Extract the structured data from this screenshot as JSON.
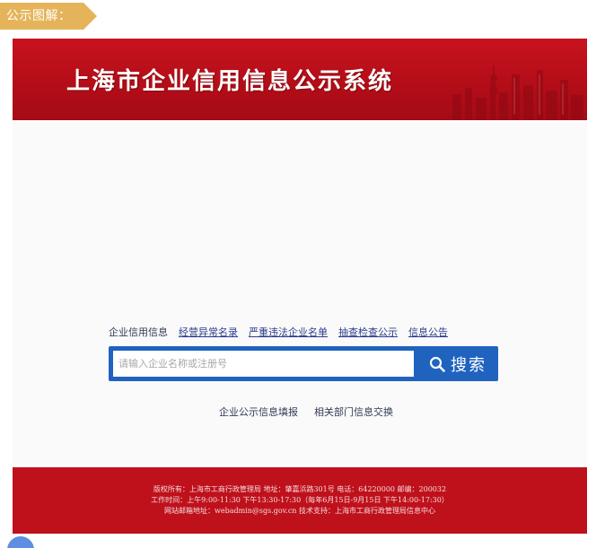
{
  "tag": {
    "label": "公示图解："
  },
  "header": {
    "site_title": "上海市企业信用信息公示系统"
  },
  "nav": {
    "links": [
      "企业信用信息",
      "经营异常名录",
      "严重违法企业名单",
      "抽查检查公示",
      "信息公告"
    ]
  },
  "search": {
    "placeholder": "请输入企业名称或注册号",
    "value": "",
    "button_label": "搜索",
    "icon": "search-icon"
  },
  "sub_links": [
    "企业公示信息填报",
    "相关部门信息交换"
  ],
  "footer": {
    "lines": [
      "版权所有：上海市工商行政管理局  地址：肇嘉浜路301号  电话：64220000  邮编：200032",
      "工作时间：上午9:00-11:30  下午13:30-17:30（每年6月15日-9月15日  下午14:00-17:30）",
      "网站邮箱地址：webadmin@sgs.gov.cn  技术支持：上海市工商行政管理局信息中心"
    ]
  },
  "colors": {
    "header_red": "#c8131f",
    "footer_red": "#bf111c",
    "search_blue": "#1f63bf",
    "tag_gold": "#e5b45a",
    "link_blue": "#2b3d8c"
  }
}
